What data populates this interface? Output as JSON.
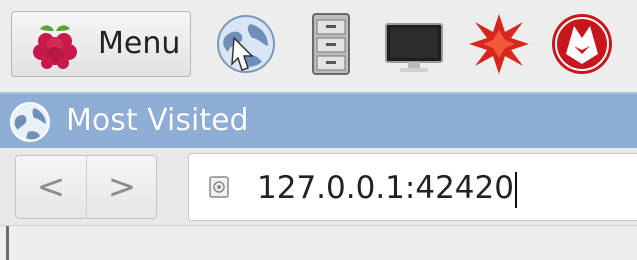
{
  "taskbar": {
    "menu_label": "Menu",
    "launchers": [
      "web-browser-icon",
      "file-manager-icon",
      "terminal-icon",
      "mathematica-icon",
      "wolfram-icon"
    ]
  },
  "window": {
    "title": "Most Visited"
  },
  "navbar": {
    "back_glyph": "<",
    "forward_glyph": ">",
    "url": "127.0.0.1:42420"
  },
  "colors": {
    "titlebar": "#8eaed6",
    "mathematica_red": "#d9261c",
    "wolfram_red": "#c8161d"
  }
}
